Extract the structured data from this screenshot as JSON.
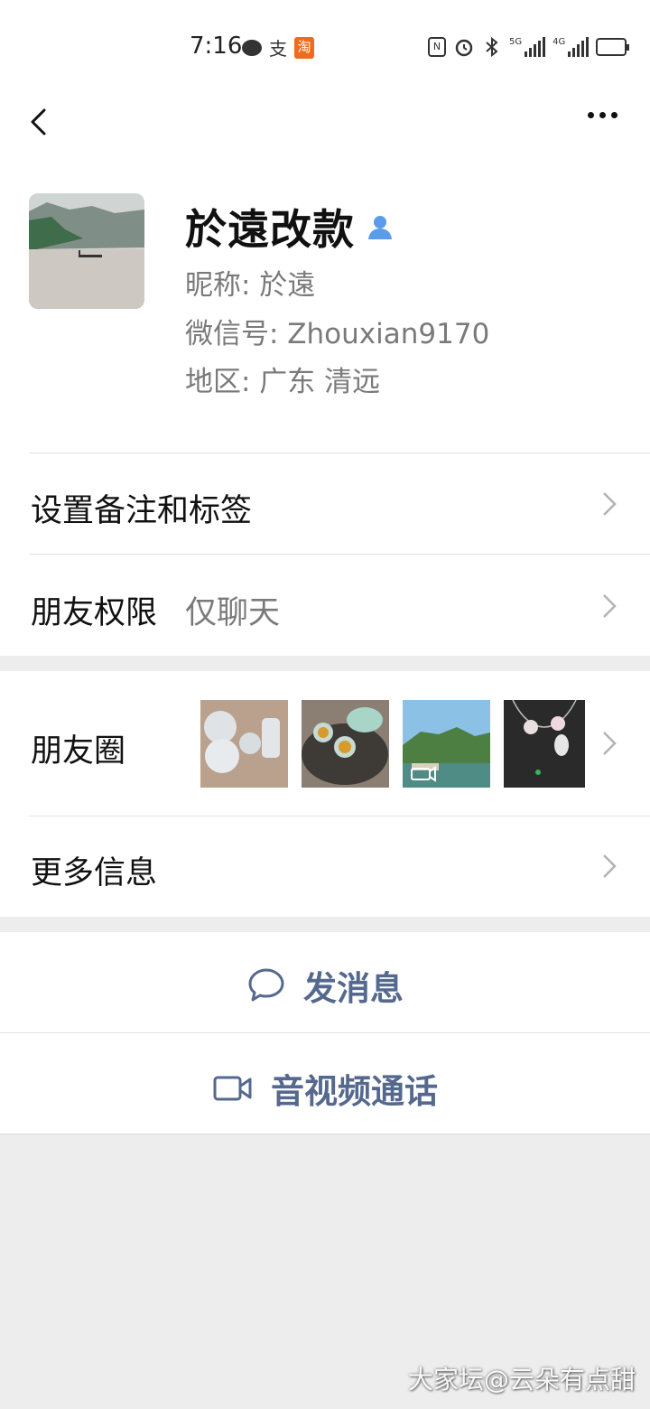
{
  "status_bar": {
    "time": "7:16",
    "icons": [
      "chat-bubble-icon",
      "alipay-icon",
      "taobao-icon",
      "nfc-icon",
      "alarm-icon",
      "bluetooth-icon",
      "signal-5g-icon",
      "signal-4g-icon",
      "battery-icon"
    ],
    "alipay_glyph": "支",
    "taobao_glyph": "淘",
    "nfc_glyph": "N",
    "sig1_label": "5G",
    "sig2_label": "4G"
  },
  "profile": {
    "display_name": "於遠改款",
    "nickname": "昵称:  於遠",
    "wechat_id": "微信号:  Zhouxian9170",
    "region": "地区:  广东  清远"
  },
  "list": {
    "remarks_tags": "设置备注和标签",
    "friend_permissions_label": "朋友权限",
    "friend_permissions_value": "仅聊天",
    "moments_label": "朋友圈",
    "more_info": "更多信息"
  },
  "actions": {
    "send_message": "发消息",
    "av_call": "音视频通话"
  },
  "colors": {
    "action_text": "#55698f",
    "background": "#ededed",
    "friend_icon": "#5b9bea"
  },
  "watermark": "大家坛@云朵有点甜"
}
